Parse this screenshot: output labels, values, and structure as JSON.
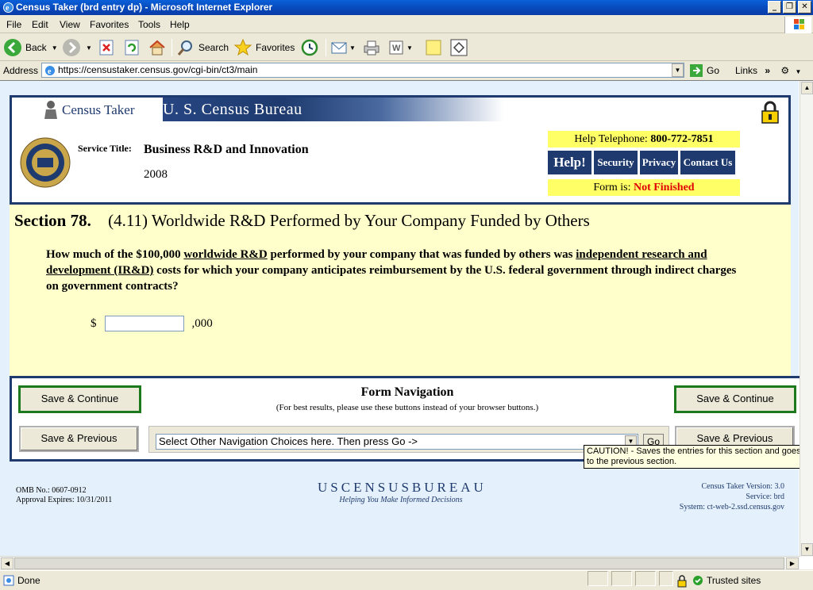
{
  "window": {
    "title": "Census Taker (brd entry dp) - Microsoft Internet Explorer"
  },
  "menu": {
    "items": [
      "File",
      "Edit",
      "View",
      "Favorites",
      "Tools",
      "Help"
    ]
  },
  "toolbar": {
    "back_label": "Back",
    "search_label": "Search",
    "favorites_label": "Favorites"
  },
  "address": {
    "label": "Address",
    "url": "https://censustaker.census.gov/cgi-bin/ct3/main",
    "go_label": "Go",
    "links_label": "Links"
  },
  "header": {
    "brand": "Census Taker",
    "bureau": "U. S. Census Bureau",
    "service_label": "Service Title:",
    "service_title": "Business R&D and Innovation",
    "year": "2008",
    "help_tel_label": "Help Telephone:",
    "help_tel_number": "800-772-7851",
    "help_button": "Help!",
    "security_button": "Security",
    "privacy_button": "Privacy",
    "contact_button": "Contact Us",
    "form_status_label": "Form is:",
    "form_status": "Not Finished"
  },
  "section": {
    "number": "Section 78.",
    "title": "(4.11) Worldwide R&D Performed by Your Company Funded by Others",
    "q_part1": "How much of the $100,000 ",
    "q_link1": "worldwide R&D",
    "q_part2": " performed by your company that was funded by others was ",
    "q_link2": "independent research and development (IR&D)",
    "q_part3": " costs for which your company anticipates reimbursement by the U.S. federal government through indirect charges on government contracts?",
    "currency": "$",
    "amount_value": "",
    "suffix": ",000"
  },
  "nav": {
    "title": "Form Navigation",
    "subtitle": "(For best results, please use these buttons instead of your browser buttons.)",
    "save_continue": "Save & Continue",
    "save_previous": "Save & Previous",
    "select_text": "Select Other Navigation Choices here. Then press Go ->",
    "go_label": "Go",
    "tooltip": "CAUTION! - Saves the entries for this section and goes to the previous section."
  },
  "footer": {
    "omb": "OMB No.: 0607-0912",
    "approval": "Approval Expires: 10/31/2011",
    "logo_text": "USCENSUSBUREAU",
    "tagline": "Helping You Make Informed Decisions",
    "version": "Census Taker Version: 3.0",
    "service": "Service: brd",
    "system": "System: ct-web-2.ssd.census.gov"
  },
  "status": {
    "text": "Done",
    "zone": "Trusted sites"
  },
  "colors": {
    "navy": "#1e3a6e",
    "yellow": "#ffff66",
    "cream": "#ffffcc",
    "green_border": "#1c7a1c",
    "status_red": "#e00000"
  }
}
